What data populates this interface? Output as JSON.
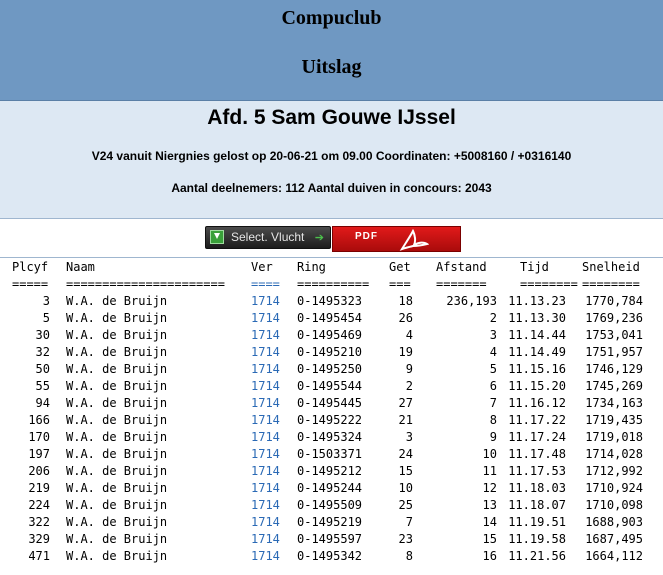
{
  "header": {
    "club": "Compuclub",
    "title": "Uitslag"
  },
  "info": {
    "afdeling": "Afd. 5 Sam Gouwe IJssel",
    "flight": "V24 vanuit Niergnies gelost op 20-06-21 om 09.00 Coordinaten: +5008160 / +0316140",
    "counts": "Aantal deelnemers: 112 Aantal duiven in concours: 2043"
  },
  "buttons": {
    "select_label": "Select. Vlucht",
    "pdf_label": "PDF"
  },
  "columns": {
    "plcyf": "Plcyf",
    "naam": "Naam",
    "ver": "Ver",
    "ring": "Ring",
    "get": "Get",
    "afstand": "Afstand",
    "tijd": "Tijd",
    "snelheid": "Snelheid"
  },
  "separators": {
    "plcyf": "=====",
    "naam": "======================",
    "ver": "====",
    "ring": "==========",
    "get": "===",
    "afstand": "=======",
    "tijd": "========",
    "snelheid": "========"
  },
  "rows": [
    {
      "plc": "3",
      "naam": "W.A. de Bruijn",
      "ver": "1714",
      "ring": "0-1495323",
      "get": "18",
      "afstand": "236,193",
      "tijd": "11.13.23",
      "snel": "1770,784"
    },
    {
      "plc": "5",
      "naam": "W.A. de Bruijn",
      "ver": "1714",
      "ring": "0-1495454",
      "get": "26",
      "afstand": "2",
      "tijd": "11.13.30",
      "snel": "1769,236"
    },
    {
      "plc": "30",
      "naam": "W.A. de Bruijn",
      "ver": "1714",
      "ring": "0-1495469",
      "get": "4",
      "afstand": "3",
      "tijd": "11.14.44",
      "snel": "1753,041"
    },
    {
      "plc": "32",
      "naam": "W.A. de Bruijn",
      "ver": "1714",
      "ring": "0-1495210",
      "get": "19",
      "afstand": "4",
      "tijd": "11.14.49",
      "snel": "1751,957"
    },
    {
      "plc": "50",
      "naam": "W.A. de Bruijn",
      "ver": "1714",
      "ring": "0-1495250",
      "get": "9",
      "afstand": "5",
      "tijd": "11.15.16",
      "snel": "1746,129"
    },
    {
      "plc": "55",
      "naam": "W.A. de Bruijn",
      "ver": "1714",
      "ring": "0-1495544",
      "get": "2",
      "afstand": "6",
      "tijd": "11.15.20",
      "snel": "1745,269"
    },
    {
      "plc": "94",
      "naam": "W.A. de Bruijn",
      "ver": "1714",
      "ring": "0-1495445",
      "get": "27",
      "afstand": "7",
      "tijd": "11.16.12",
      "snel": "1734,163"
    },
    {
      "plc": "166",
      "naam": "W.A. de Bruijn",
      "ver": "1714",
      "ring": "0-1495222",
      "get": "21",
      "afstand": "8",
      "tijd": "11.17.22",
      "snel": "1719,435"
    },
    {
      "plc": "170",
      "naam": "W.A. de Bruijn",
      "ver": "1714",
      "ring": "0-1495324",
      "get": "3",
      "afstand": "9",
      "tijd": "11.17.24",
      "snel": "1719,018"
    },
    {
      "plc": "197",
      "naam": "W.A. de Bruijn",
      "ver": "1714",
      "ring": "0-1503371",
      "get": "24",
      "afstand": "10",
      "tijd": "11.17.48",
      "snel": "1714,028"
    },
    {
      "plc": "206",
      "naam": "W.A. de Bruijn",
      "ver": "1714",
      "ring": "0-1495212",
      "get": "15",
      "afstand": "11",
      "tijd": "11.17.53",
      "snel": "1712,992"
    },
    {
      "plc": "219",
      "naam": "W.A. de Bruijn",
      "ver": "1714",
      "ring": "0-1495244",
      "get": "10",
      "afstand": "12",
      "tijd": "11.18.03",
      "snel": "1710,924"
    },
    {
      "plc": "224",
      "naam": "W.A. de Bruijn",
      "ver": "1714",
      "ring": "0-1495509",
      "get": "25",
      "afstand": "13",
      "tijd": "11.18.07",
      "snel": "1710,098"
    },
    {
      "plc": "322",
      "naam": "W.A. de Bruijn",
      "ver": "1714",
      "ring": "0-1495219",
      "get": "7",
      "afstand": "14",
      "tijd": "11.19.51",
      "snel": "1688,903"
    },
    {
      "plc": "329",
      "naam": "W.A. de Bruijn",
      "ver": "1714",
      "ring": "0-1495597",
      "get": "23",
      "afstand": "15",
      "tijd": "11.19.58",
      "snel": "1687,495"
    },
    {
      "plc": "471",
      "naam": "W.A. de Bruijn",
      "ver": "1714",
      "ring": "0-1495342",
      "get": "8",
      "afstand": "16",
      "tijd": "11.21.56",
      "snel": "1664,112"
    }
  ]
}
